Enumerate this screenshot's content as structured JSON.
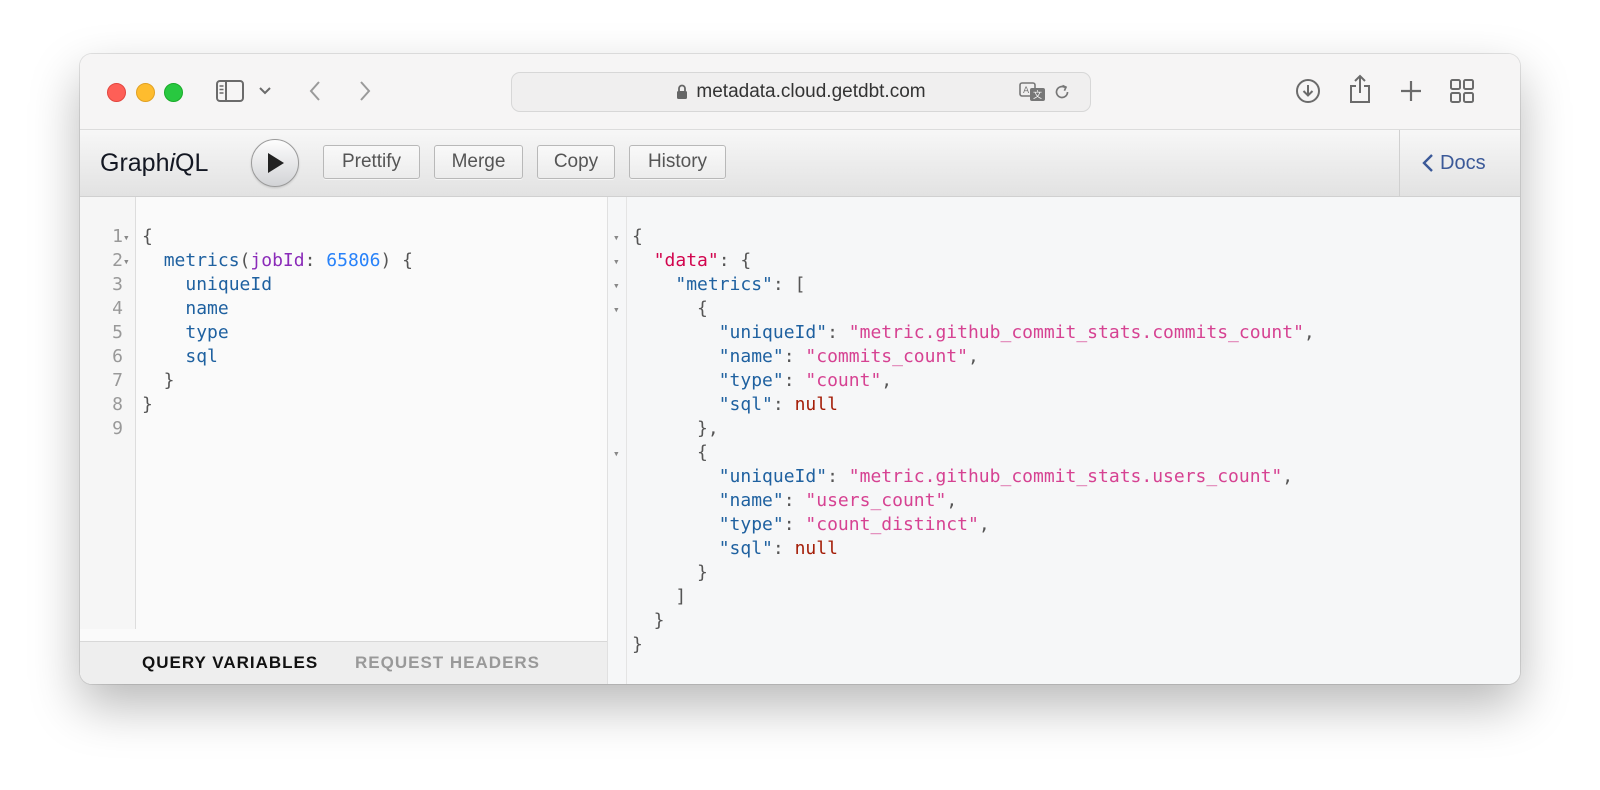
{
  "browser": {
    "url": "metadata.cloud.getdbt.com"
  },
  "graphiql": {
    "title_prefix": "Graph",
    "title_italic": "i",
    "title_suffix": "QL",
    "buttons": {
      "prettify": "Prettify",
      "merge": "Merge",
      "copy": "Copy",
      "history": "History"
    },
    "docs_label": "Docs"
  },
  "query_editor": {
    "line_numbers": [
      "1",
      "2",
      "3",
      "4",
      "5",
      "6",
      "7",
      "8",
      "9"
    ],
    "lines": [
      [
        {
          "t": "{",
          "c": "punc"
        }
      ],
      [
        {
          "t": "  ",
          "c": "punc"
        },
        {
          "t": "metrics",
          "c": "field"
        },
        {
          "t": "(",
          "c": "punc"
        },
        {
          "t": "jobId",
          "c": "arg"
        },
        {
          "t": ": ",
          "c": "punc"
        },
        {
          "t": "65806",
          "c": "num"
        },
        {
          "t": ") {",
          "c": "punc"
        }
      ],
      [
        {
          "t": "    ",
          "c": "punc"
        },
        {
          "t": "uniqueId",
          "c": "field"
        }
      ],
      [
        {
          "t": "    ",
          "c": "punc"
        },
        {
          "t": "name",
          "c": "field"
        }
      ],
      [
        {
          "t": "    ",
          "c": "punc"
        },
        {
          "t": "type",
          "c": "field"
        }
      ],
      [
        {
          "t": "    ",
          "c": "punc"
        },
        {
          "t": "sql",
          "c": "field"
        }
      ],
      [
        {
          "t": "  }",
          "c": "punc"
        }
      ],
      [
        {
          "t": "}",
          "c": "punc"
        }
      ],
      [
        {
          "t": "",
          "c": "punc"
        }
      ]
    ],
    "fold_lines": [
      0,
      1
    ],
    "tabs": {
      "query_variables": "QUERY VARIABLES",
      "request_headers": "REQUEST HEADERS"
    }
  },
  "result": {
    "lines": [
      [
        {
          "t": "{",
          "c": "punc"
        }
      ],
      [
        {
          "t": "  ",
          "c": "punc"
        },
        {
          "t": "\"data\"",
          "c": "keytop"
        },
        {
          "t": ": {",
          "c": "punc"
        }
      ],
      [
        {
          "t": "    ",
          "c": "punc"
        },
        {
          "t": "\"metrics\"",
          "c": "key"
        },
        {
          "t": ": [",
          "c": "punc"
        }
      ],
      [
        {
          "t": "      {",
          "c": "punc"
        }
      ],
      [
        {
          "t": "        ",
          "c": "punc"
        },
        {
          "t": "\"uniqueId\"",
          "c": "key"
        },
        {
          "t": ": ",
          "c": "punc"
        },
        {
          "t": "\"metric.github_commit_stats.commits_count\"",
          "c": "str"
        },
        {
          "t": ",",
          "c": "punc"
        }
      ],
      [
        {
          "t": "        ",
          "c": "punc"
        },
        {
          "t": "\"name\"",
          "c": "key"
        },
        {
          "t": ": ",
          "c": "punc"
        },
        {
          "t": "\"commits_count\"",
          "c": "str"
        },
        {
          "t": ",",
          "c": "punc"
        }
      ],
      [
        {
          "t": "        ",
          "c": "punc"
        },
        {
          "t": "\"type\"",
          "c": "key"
        },
        {
          "t": ": ",
          "c": "punc"
        },
        {
          "t": "\"count\"",
          "c": "str"
        },
        {
          "t": ",",
          "c": "punc"
        }
      ],
      [
        {
          "t": "        ",
          "c": "punc"
        },
        {
          "t": "\"sql\"",
          "c": "key"
        },
        {
          "t": ": ",
          "c": "punc"
        },
        {
          "t": "null",
          "c": "null"
        }
      ],
      [
        {
          "t": "      },",
          "c": "punc"
        }
      ],
      [
        {
          "t": "      {",
          "c": "punc"
        }
      ],
      [
        {
          "t": "        ",
          "c": "punc"
        },
        {
          "t": "\"uniqueId\"",
          "c": "key"
        },
        {
          "t": ": ",
          "c": "punc"
        },
        {
          "t": "\"metric.github_commit_stats.users_count\"",
          "c": "str"
        },
        {
          "t": ",",
          "c": "punc"
        }
      ],
      [
        {
          "t": "        ",
          "c": "punc"
        },
        {
          "t": "\"name\"",
          "c": "key"
        },
        {
          "t": ": ",
          "c": "punc"
        },
        {
          "t": "\"users_count\"",
          "c": "str"
        },
        {
          "t": ",",
          "c": "punc"
        }
      ],
      [
        {
          "t": "        ",
          "c": "punc"
        },
        {
          "t": "\"type\"",
          "c": "key"
        },
        {
          "t": ": ",
          "c": "punc"
        },
        {
          "t": "\"count_distinct\"",
          "c": "str"
        },
        {
          "t": ",",
          "c": "punc"
        }
      ],
      [
        {
          "t": "        ",
          "c": "punc"
        },
        {
          "t": "\"sql\"",
          "c": "key"
        },
        {
          "t": ": ",
          "c": "punc"
        },
        {
          "t": "null",
          "c": "null"
        }
      ],
      [
        {
          "t": "      }",
          "c": "punc"
        }
      ],
      [
        {
          "t": "    ]",
          "c": "punc"
        }
      ],
      [
        {
          "t": "  }",
          "c": "punc"
        }
      ],
      [
        {
          "t": "}",
          "c": "punc"
        }
      ]
    ],
    "fold_lines": [
      0,
      1,
      2,
      3,
      9
    ]
  },
  "icons": {
    "sidebar": "sidebar-icon",
    "back": "chevron-left-icon",
    "forward": "chevron-right-icon",
    "lock": "lock-icon",
    "translate": "translate-icon",
    "reload": "reload-icon",
    "download": "download-icon",
    "share": "share-icon",
    "new_tab": "plus-icon",
    "tab_overview": "grid-icon",
    "execute": "play-icon"
  },
  "colors": {
    "field": "#1f61a0",
    "argument": "#8b2bb9",
    "number": "#2882f9",
    "string": "#d64292",
    "null": "#a41d07",
    "docs_link": "#3b5998"
  }
}
